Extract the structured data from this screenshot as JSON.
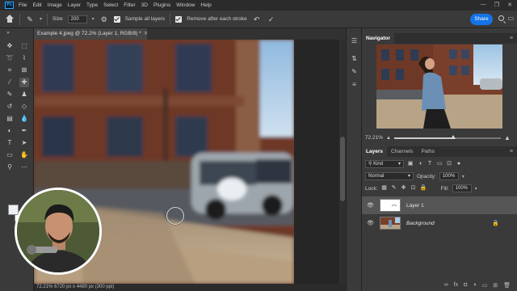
{
  "menubar": {
    "logo": "Ps",
    "items": [
      "File",
      "Edit",
      "Image",
      "Layer",
      "Type",
      "Select",
      "Filter",
      "3D",
      "Plugins",
      "Window",
      "Help"
    ],
    "window_controls": [
      "—",
      "❐",
      "✕"
    ]
  },
  "options": {
    "size_label": "Size",
    "size_value": "200",
    "sample_all_layers": "Sample all layers",
    "remove_after_stroke": "Remove after each stroke",
    "share": "Share"
  },
  "document": {
    "tab_title": "Example 4.jpeg @ 72.2% (Layer 1, RGB/8) *",
    "status": "72.21%   6720 px x 4480 px (300 ppi)"
  },
  "navigator": {
    "tab": "Navigator",
    "zoom": "72.21%",
    "zoom_fraction": 0.55
  },
  "layers_panel": {
    "tabs": [
      "Layers",
      "Channels",
      "Paths"
    ],
    "kind_label": "Kind",
    "blend_mode": "Normal",
    "opacity_label": "Opacity:",
    "opacity_value": "100%",
    "lock_label": "Lock:",
    "fill_label": "Fill:",
    "fill_value": "100%",
    "layers": [
      {
        "name": "Layer 1",
        "selected": true
      },
      {
        "name": "Background",
        "selected": false
      }
    ]
  },
  "colors": {
    "accent": "#1473e6",
    "foreground": "#eef0f7",
    "background": "#ffffff"
  }
}
